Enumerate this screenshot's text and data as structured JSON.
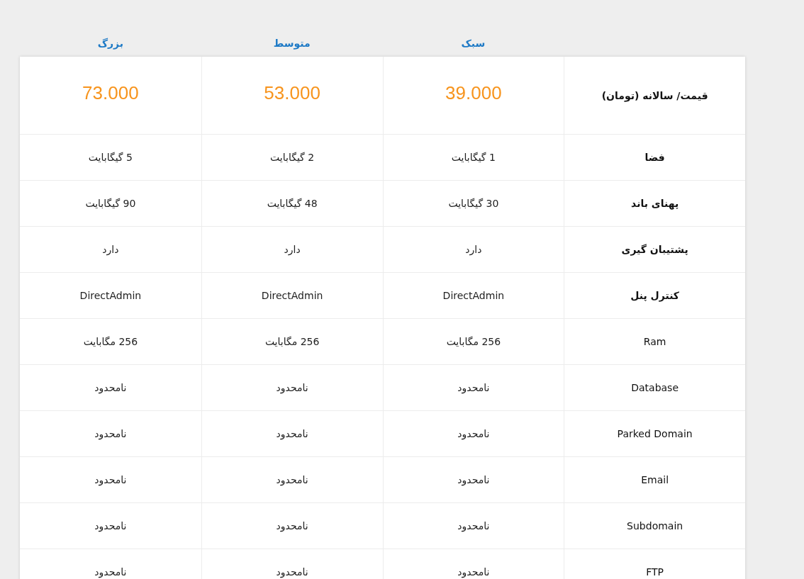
{
  "plans": [
    {
      "name": "سبک",
      "price": "39.000"
    },
    {
      "name": "متوسط",
      "price": "53.000"
    },
    {
      "name": "بزرگ",
      "price": "73.000"
    }
  ],
  "price_label": "قیمت/ سالانه (تومان)",
  "rows": [
    {
      "label": "فضا",
      "values": [
        "1 گیگابایت",
        "2 گیگابایت",
        "5 گیگابایت"
      ]
    },
    {
      "label": "پهنای باند",
      "values": [
        "30 گیگابایت",
        "48 گیگابایت",
        "90 گیگابایت"
      ]
    },
    {
      "label": "پشتیبان گیری",
      "values": [
        "دارد",
        "دارد",
        "دارد"
      ]
    },
    {
      "label": "کنترل پنل",
      "values": [
        "DirectAdmin",
        "DirectAdmin",
        "DirectAdmin"
      ]
    },
    {
      "label": "Ram",
      "values": [
        "256 مگابایت",
        "256 مگابایت",
        "256 مگابایت"
      ]
    },
    {
      "label": "Database",
      "values": [
        "نامحدود",
        "نامحدود",
        "نامحدود"
      ]
    },
    {
      "label": "Parked Domain",
      "values": [
        "نامحدود",
        "نامحدود",
        "نامحدود"
      ]
    },
    {
      "label": "Email",
      "values": [
        "نامحدود",
        "نامحدود",
        "نامحدود"
      ]
    },
    {
      "label": "Subdomain",
      "values": [
        "نامحدود",
        "نامحدود",
        "نامحدود"
      ]
    },
    {
      "label": "FTP",
      "values": [
        "نامحدود",
        "نامحدود",
        "نامحدود"
      ]
    }
  ]
}
